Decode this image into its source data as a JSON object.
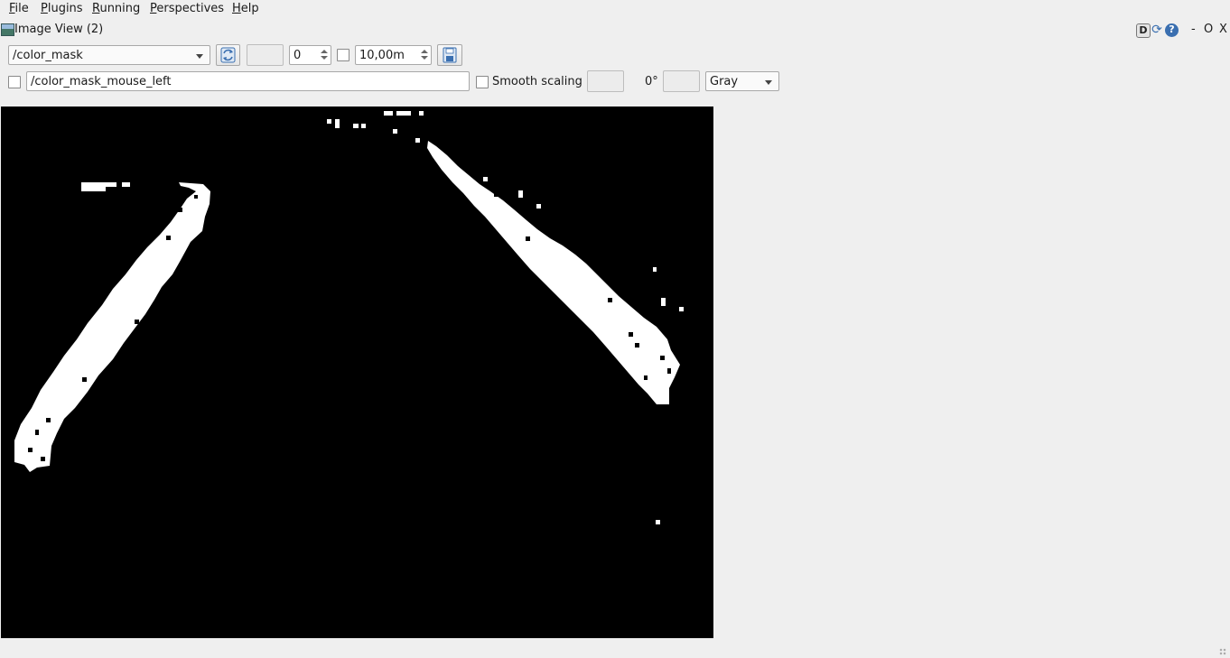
{
  "menubar": {
    "items": [
      {
        "label": "File",
        "mnemonic": "F",
        "rest": "ile"
      },
      {
        "label": "Plugins",
        "mnemonic": "P",
        "rest": "lugins"
      },
      {
        "label": "Running",
        "mnemonic": "R",
        "rest": "unning"
      },
      {
        "label": "Perspectives",
        "mnemonic": "P",
        "rest": "erspectives"
      },
      {
        "label": "Help",
        "mnemonic": "H",
        "rest": "elp"
      }
    ]
  },
  "plugin": {
    "title": "Image View (2)",
    "debug_button_label": "D",
    "help_button_label": "?",
    "window_controls": {
      "minimize": "-",
      "float": "O",
      "close": "X"
    }
  },
  "toolbar": {
    "topic": "/color_mask",
    "refresh_icon": "refresh-icon",
    "rotation_offset": "0",
    "max_range": "10,00m",
    "save_icon": "save-icon"
  },
  "toolbar2": {
    "mouse_topic": "/color_mask_mouse_left",
    "smooth_scaling_label": "Smooth scaling",
    "rotation_label": "0°",
    "colormap": "Gray"
  },
  "image": {
    "description_colors": {
      "background": "#000000",
      "mask": "#ffffff"
    }
  }
}
